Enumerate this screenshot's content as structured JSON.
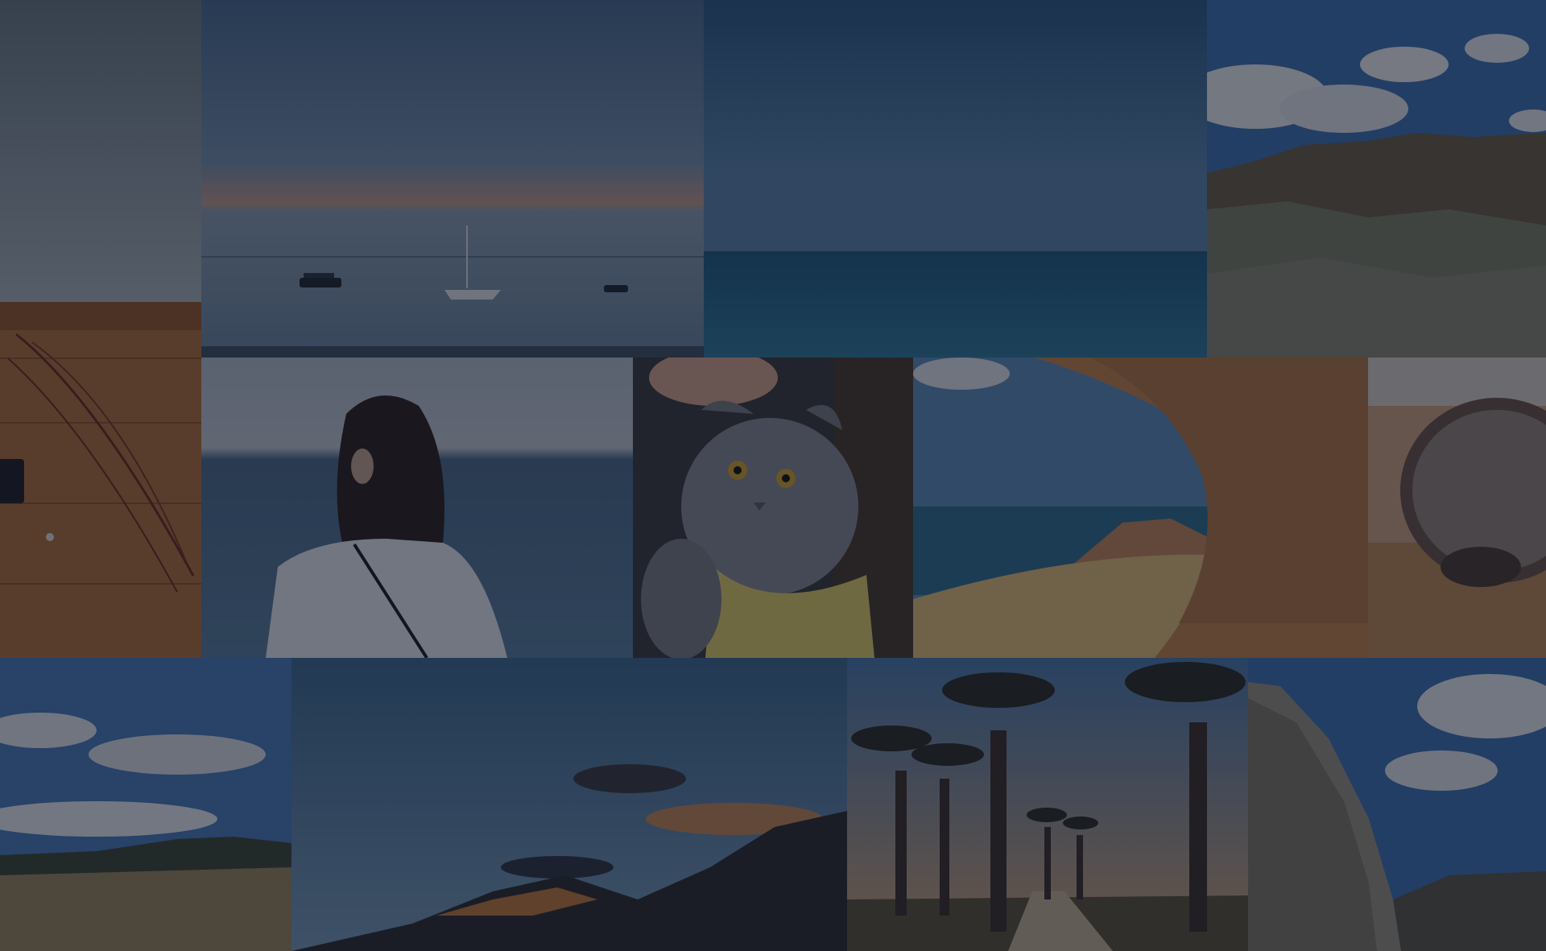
{
  "gallery": {
    "tiles": [
      {
        "row": 1,
        "subject": "overcast-sky"
      },
      {
        "row": 1,
        "subject": "sailboats-at-dusk"
      },
      {
        "row": 1,
        "subject": "open-sea-horizon"
      },
      {
        "row": 1,
        "subject": "rocky-cliff-clouds"
      },
      {
        "row": 2,
        "subject": "wooden-table-twigs"
      },
      {
        "row": 2,
        "subject": "woman-by-sea"
      },
      {
        "row": 2,
        "subject": "grey-scottish-fold-cat"
      },
      {
        "row": 2,
        "subject": "sea-cave-beach"
      },
      {
        "row": 2,
        "subject": "hedgehog"
      },
      {
        "row": 3,
        "subject": "savanna-plain"
      },
      {
        "row": 3,
        "subject": "mountain-sunset"
      },
      {
        "row": 3,
        "subject": "baobab-avenue"
      },
      {
        "row": 3,
        "subject": "rock-cliff-sky"
      }
    ],
    "overlay_color": "#0c1220"
  }
}
